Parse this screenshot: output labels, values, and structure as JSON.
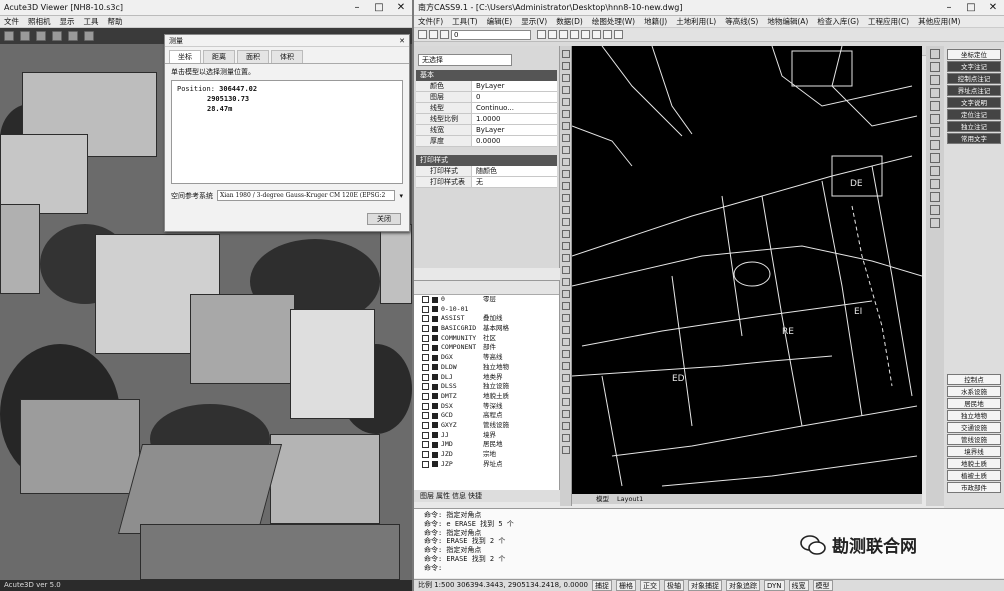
{
  "left_window": {
    "title": "Acute3D Viewer [NH8-10.s3c]",
    "menu": [
      "文件",
      "照相机",
      "显示",
      "工具",
      "帮助"
    ],
    "status_text": "Acute3D ver 5.0"
  },
  "dialog": {
    "title": "测量",
    "tabs": [
      "坐标",
      "距离",
      "面积",
      "体积"
    ],
    "instruction": "单击模型以选择测量位置。",
    "position_label": "Position:",
    "x": "306447.02",
    "y": "2905130.73",
    "z": "28.47m",
    "crs_label": "空间参考系统",
    "crs_value": "Xian 1980 / 3-degree Gauss-Kruger CM 120E (EPSG:2",
    "close_label": "关闭"
  },
  "right_window": {
    "title": "南方CASS9.1 - [C:\\Users\\Administrator\\Desktop\\hnn8-10-new.dwg]",
    "menu": [
      "文件(F)",
      "工具(T)",
      "编辑(E)",
      "显示(V)",
      "数据(D)",
      "绘图处理(W)",
      "地籍(J)",
      "土地利用(L)",
      "等高线(S)",
      "地物编辑(A)",
      "检查入库(G)",
      "工程应用(C)",
      "其他应用(M)"
    ],
    "layer_dropdown": "0",
    "props_dropdown": "无选择",
    "props_section": "基本",
    "props": [
      {
        "k": "颜色",
        "v": "ByLayer"
      },
      {
        "k": "图层",
        "v": "0"
      },
      {
        "k": "线型",
        "v": "Continuo..."
      },
      {
        "k": "线型比例",
        "v": "1.0000"
      },
      {
        "k": "线宽",
        "v": "ByLayer"
      },
      {
        "k": "厚度",
        "v": "0.0000"
      }
    ],
    "print_section": "打印样式",
    "print_props": [
      {
        "k": "打印样式",
        "v": "随颜色"
      },
      {
        "k": "打印样式表",
        "v": "无"
      }
    ],
    "layers": [
      {
        "name": "0",
        "desc": "零层"
      },
      {
        "name": "0-10-01",
        "desc": ""
      },
      {
        "name": "ASSIST",
        "desc": "叠加线"
      },
      {
        "name": "BASICGRID",
        "desc": "基本网格"
      },
      {
        "name": "COMMUNITY",
        "desc": "社区"
      },
      {
        "name": "COMPONENT",
        "desc": "部件"
      },
      {
        "name": "DGX",
        "desc": "等高线"
      },
      {
        "name": "DLDW",
        "desc": "独立地物"
      },
      {
        "name": "DLJ",
        "desc": "地类界"
      },
      {
        "name": "DLSS",
        "desc": "独立设施"
      },
      {
        "name": "DMTZ",
        "desc": "地貌土质"
      },
      {
        "name": "DSX",
        "desc": "等深线"
      },
      {
        "name": "GCD",
        "desc": "高程点"
      },
      {
        "name": "GXYZ",
        "desc": "管线设施"
      },
      {
        "name": "JJ",
        "desc": "境界"
      },
      {
        "name": "JMD",
        "desc": "居民地"
      },
      {
        "name": "JZD",
        "desc": "宗地"
      },
      {
        "name": "JZP",
        "desc": "界址点"
      }
    ],
    "panel_tabs": [
      "图层",
      "属性",
      "信息",
      "快捷"
    ],
    "layout_tabs": [
      "模型",
      "Layout1"
    ],
    "canvas_labels": [
      "ED",
      "RE",
      "EI",
      "DE"
    ],
    "cmd_buttons_top": [
      "坐标定位",
      "文字注记",
      "控制点注记",
      "界址点注记",
      "文字说明",
      "定位注记",
      "独立注记",
      "常用文字"
    ],
    "cmd_buttons_bottom": [
      "控制点",
      "水系设施",
      "居民地",
      "独立地物",
      "交通设施",
      "管线设施",
      "境界线",
      "地貌土质",
      "植被土质",
      "市政部件"
    ],
    "cmd_lines": [
      "命令: 指定对角点",
      "命令: e ERASE 找到 5 个",
      "命令: 指定对角点",
      "命令: ERASE 找到 2 个",
      "命令: 指定对角点",
      "命令: ERASE 找到 2 个",
      "命令:"
    ],
    "status_coords": "比例 1:500  306394.3443, 2905134.2418, 0.0000",
    "status_buttons": [
      "捕捉",
      "栅格",
      "正交",
      "极轴",
      "对象捕捉",
      "对象追踪",
      "DYN",
      "线宽",
      "模型"
    ]
  },
  "watermark": "勘测联合网"
}
